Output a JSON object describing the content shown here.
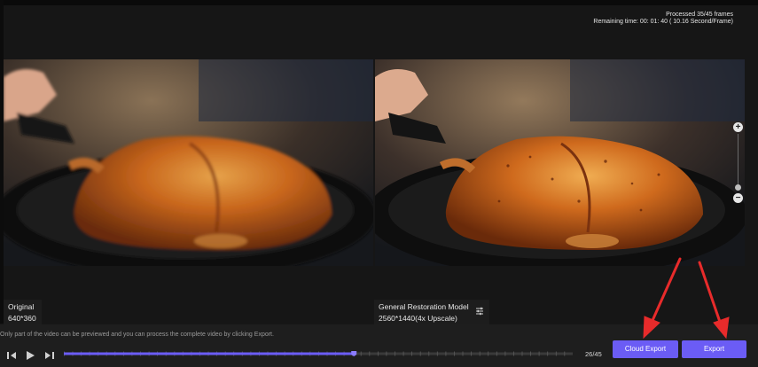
{
  "status": {
    "processed": "Processed 35/45 frames",
    "remaining": "Remaining time: 00: 01: 40 ( 10.16 Second/Frame)"
  },
  "left_pane": {
    "title": "Original",
    "resolution": "640*360"
  },
  "right_pane": {
    "title": "General Restoration Model",
    "resolution": "2560*1440(4x Upscale)"
  },
  "footer": {
    "hint": "Only part of the video can be previewed and you can process the complete video by clicking Export.",
    "frame_counter": "26/45",
    "cloud_export_label": "Cloud Export",
    "export_label": "Export"
  },
  "playback": {
    "progress": 0.57
  },
  "colors": {
    "accent": "#6b5cf5",
    "annotation_arrow": "#e82b2b"
  }
}
